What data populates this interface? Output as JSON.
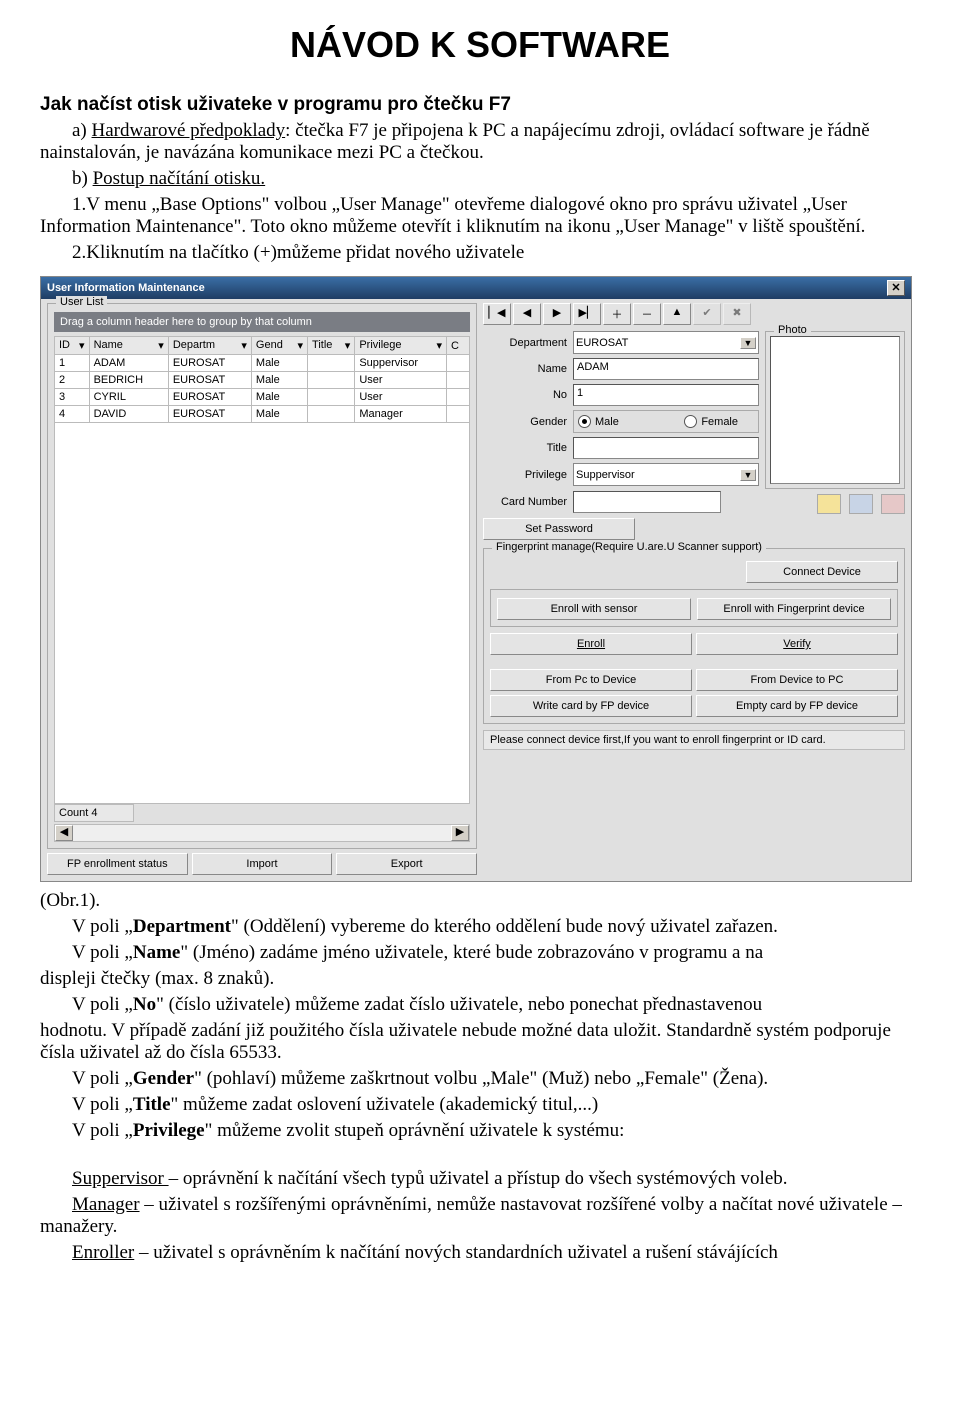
{
  "doc": {
    "title": "NÁVOD K SOFTWARE",
    "heading2": "Jak načíst otisk uživateke v programu pro čtečku F7",
    "p1_a": "a) ",
    "p1_u": "Hardwarové předpoklady",
    "p1_b": ": čtečka F7 je připojena k PC a napájecímu zdroji, ovládací software je řádně nainstalován, je navázána komunikace mezi PC a čtečkou.",
    "p2_a": "b) ",
    "p2_u": "Postup načítání otisku.",
    "p3": "1.V menu „Base Options\" volbou „User Manage\" otevřeme dialogové okno pro správu uživatel „User Information Maintenance\". Toto okno můžeme otevřít i kliknutím na ikonu „User Manage\" v liště spouštění.",
    "p4": "2.Kliknutím na tlačítko (+)můžeme přidat nového uživatele",
    "obr1": "(Obr.1).",
    "p5": "V poli „Department\" (Oddělení) vybereme do kterého oddělení bude nový uživatel zařazen.",
    "p6": "V poli „Name\" (Jméno) zadáme jméno uživatele, které bude zobrazováno v programu a na displeji čtečky (max. 8 znaků).",
    "p7": "V poli „No\" (číslo uživatele) můžeme zadat číslo uživatele, nebo ponechat přednastavenou hodnotu. V případě zadání již použitého čísla uživatele nebude možné data uložit. Standardně systém podporuje čísla uživatel až do čísla 65533.",
    "p8": "V poli „Gender\" (pohlaví) můžeme zaškrtnout volbu „Male\" (Muž) nebo „Female\" (Žena).",
    "p9": "V poli „Title\" můžeme zadat oslovení uživatele (akademický titul,...)",
    "p10": "V poli „Privilege\" můžeme zvolit stupeň oprávnění uživatele k systému:",
    "p11_u": "Suppervisor ",
    "p11": "– oprávnění k načítání všech typů uživatel a přístup do všech systémových voleb.",
    "p12_u": "Manager",
    "p12": " – uživatel s rozšířenými oprávněními, nemůže nastavovat rozšířené volby a načítat nové uživatele – manažery.",
    "p13_u": "Enroller",
    "p13": " – uživatel s oprávněním k načítání nových standardních uživatel a rušení stávájících"
  },
  "dlg": {
    "title": "User Information Maintenance",
    "userlist": "User List",
    "drag": "Drag a column header here to group by that column",
    "cols": [
      "ID",
      "Name",
      "Departm",
      "Gend",
      "Title",
      "Privilege",
      "C"
    ],
    "rows": [
      {
        "id": "1",
        "name": "ADAM",
        "dept": "EUROSAT",
        "gend": "Male",
        "title": "",
        "priv": "Suppervisor"
      },
      {
        "id": "2",
        "name": "BEDRICH",
        "dept": "EUROSAT",
        "gend": "Male",
        "title": "",
        "priv": "User"
      },
      {
        "id": "3",
        "name": "CYRIL",
        "dept": "EUROSAT",
        "gend": "Male",
        "title": "",
        "priv": "User"
      },
      {
        "id": "4",
        "name": "DAVID",
        "dept": "EUROSAT",
        "gend": "Male",
        "title": "",
        "priv": "Manager"
      }
    ],
    "count": "Count 4",
    "fp_status": "FP enrollment status",
    "import": "Import",
    "export": "Export",
    "tbicons": [
      "▏◀",
      "◀",
      "▶",
      "▶▏",
      "＋",
      "－",
      "▲",
      "✔",
      "✖"
    ],
    "field_department": "Department",
    "field_department_v": "EUROSAT",
    "field_name": "Name",
    "field_name_v": "ADAM",
    "field_no": "No",
    "field_no_v": "1",
    "field_gender": "Gender",
    "male": "Male",
    "female": "Female",
    "field_title": "Title",
    "field_priv": "Privilege",
    "field_priv_v": "Suppervisor",
    "field_card": "Card Number",
    "setpw": "Set Password",
    "photo": "Photo",
    "fp_group": "Fingerprint manage(Require U.are.U Scanner support)",
    "connectdev": "Connect Device",
    "enrollsensor": "Enroll with sensor",
    "enrollfp": "Enroll with Fingerprint device",
    "enroll": "Enroll",
    "verify": "Verify",
    "pc2dev": "From Pc to Device",
    "dev2pc": "From Device to PC",
    "writecard": "Write card by FP device",
    "emptycard": "Empty card by FP device",
    "status": "Please connect device first,If you want to enroll fingerprint or ID card."
  }
}
